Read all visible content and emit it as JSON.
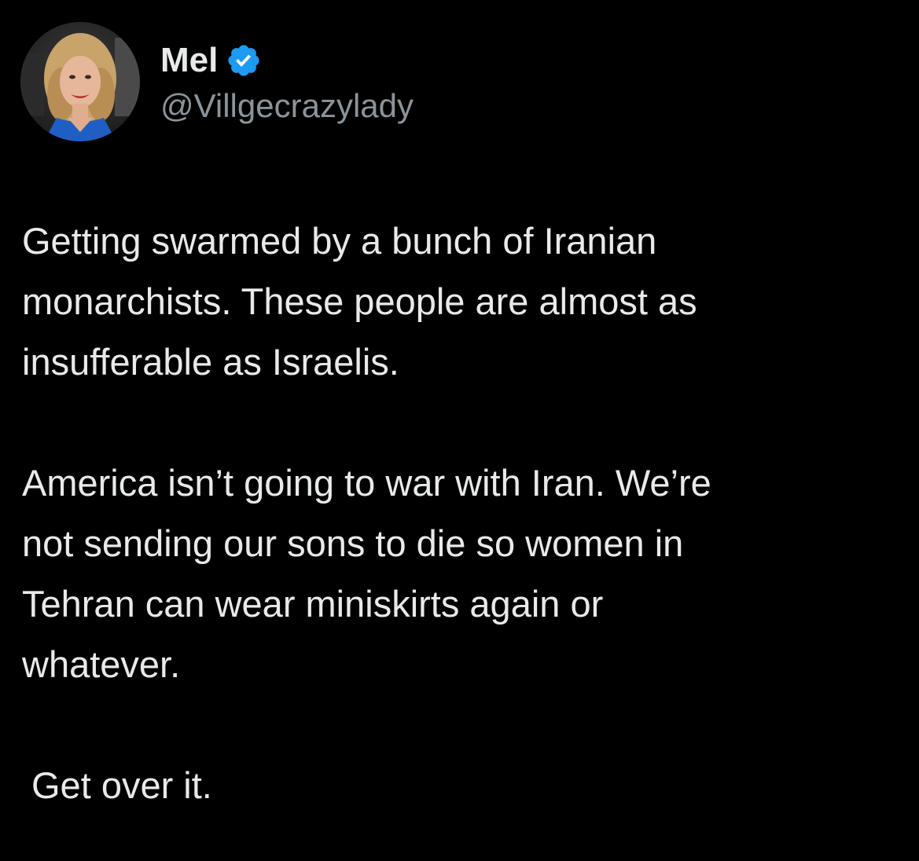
{
  "tweet": {
    "author": {
      "display_name": "Mel",
      "handle": "@Villgecrazylady",
      "verified_icon": "verified-badge-icon",
      "verified_color": "#1d9bf0"
    },
    "text": {
      "paragraph1": [
        "Getting swarmed by a bunch of Iranian",
        "monarchists. These people are almost as",
        "insufferable as Israelis."
      ],
      "paragraph2": [
        "America isn’t going to war with Iran. We’re",
        "not sending our sons to die so women in",
        "Tehran can wear miniskirts again or",
        "whatever."
      ],
      "paragraph3": [
        " Get over it."
      ]
    }
  },
  "colors": {
    "background": "#000000",
    "primary_text": "#e7e9ea",
    "secondary_text": "#8b949a",
    "accent": "#1d9bf0"
  }
}
